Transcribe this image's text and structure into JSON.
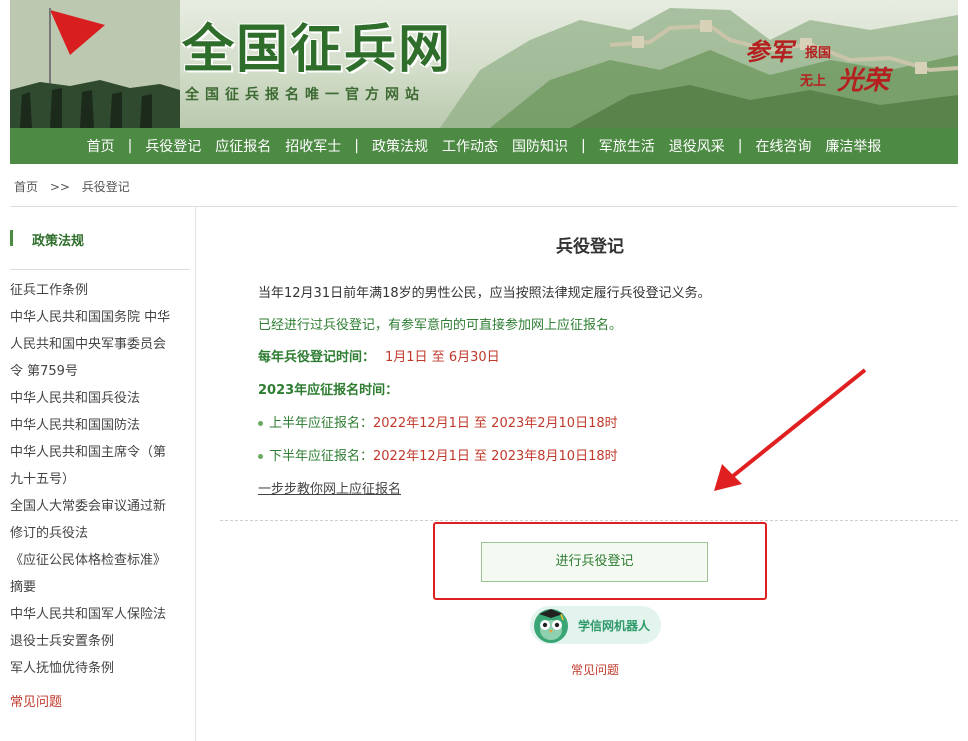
{
  "header": {
    "title": "全国征兵网",
    "subtitle": "全国征兵报名唯一官方网站",
    "slogan": {
      "line1": "参军",
      "line2": "报国",
      "line3": "无上",
      "line4": "光荣"
    }
  },
  "nav": {
    "items": [
      "首页",
      "兵役登记",
      "应征报名",
      "招收军士",
      "政策法规",
      "工作动态",
      "国防知识",
      "军旅生活",
      "退役风采",
      "在线咨询",
      "廉洁举报"
    ],
    "separator": "|"
  },
  "breadcrumb": {
    "home": "首页",
    "sep": ">>",
    "current": "兵役登记"
  },
  "sidebar": {
    "heading": "政策法规",
    "items": [
      "征兵工作条例",
      "中华人民共和国国务院 中华",
      "人民共和国中央军事委员会",
      "令 第759号",
      "中华人民共和国兵役法",
      "中华人民共和国国防法",
      "中华人民共和国主席令（第",
      "九十五号）",
      "全国人大常委会审议通过新",
      "修订的兵役法",
      "《应征公民体格检查标准》",
      "摘要",
      "中华人民共和国军人保险法",
      "退役士兵安置条例",
      "军人抚恤优待条例"
    ],
    "faq": "常见问题"
  },
  "main": {
    "title": "兵役登记",
    "intro": "当年12月31日前年满18岁的男性公民，应当按照法律规定履行兵役登记义务。",
    "notice": "已经进行过兵役登记，有参军意向的可直接参加网上应征报名。",
    "reg_time_label": "每年兵役登记时间：",
    "reg_time_value": "1月1日 至 6月30日",
    "enlist_heading": "2023年应征报名时间：",
    "first_half_label": "上半年应征报名：",
    "first_half_value": "2022年12月1日 至 2023年2月10日18时",
    "second_half_label": "下半年应征报名：",
    "second_half_value": "2022年12月1日 至 2023年8月10日18时",
    "guide_link": "一步步教你网上应征报名",
    "register_button": "进行兵役登记",
    "robot_label": "学信网机器人",
    "faq": "常见问题"
  },
  "colors": {
    "nav_bg": "#4d8a44",
    "accent_green": "#2e7d32",
    "accent_red": "#c0392b",
    "highlight": "#e02020"
  }
}
